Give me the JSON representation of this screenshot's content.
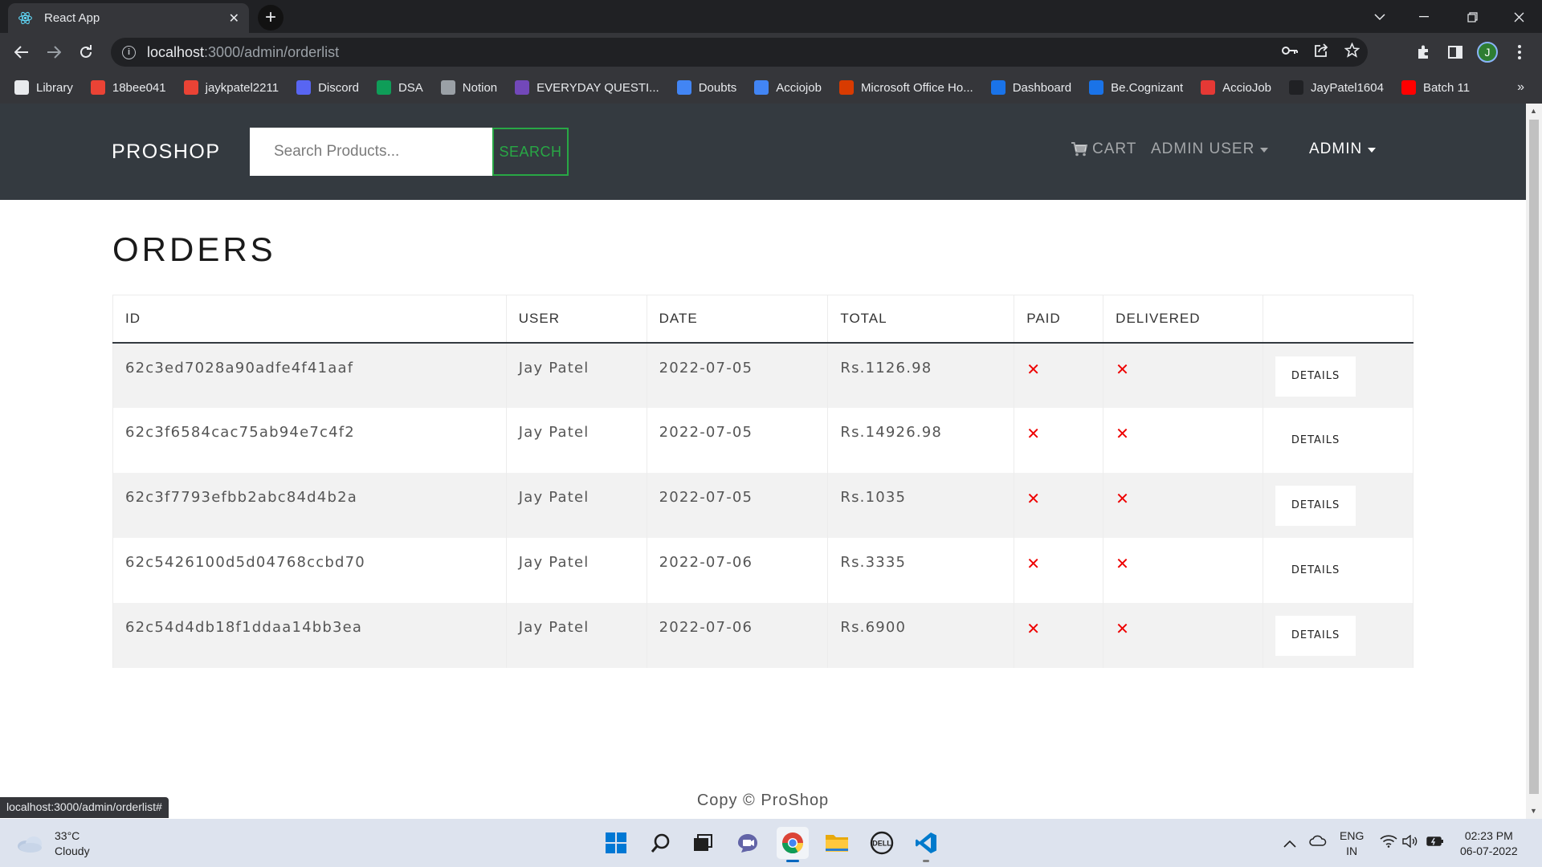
{
  "browser": {
    "tab_title": "React App",
    "url_host": "localhost",
    "url_path": ":3000/admin/orderlist",
    "profile_initial": "J",
    "bookmarks": [
      {
        "label": "Library",
        "icon": "library-icon",
        "color": "#e8eaed"
      },
      {
        "label": "18bee041",
        "icon": "gmail-icon",
        "color": "#ea4335"
      },
      {
        "label": "jaykpatel2211",
        "icon": "gmail-icon",
        "color": "#ea4335"
      },
      {
        "label": "Discord",
        "icon": "discord-icon",
        "color": "#5865f2"
      },
      {
        "label": "DSA",
        "icon": "sheets-icon",
        "color": "#0f9d58"
      },
      {
        "label": "Notion",
        "icon": "notion-icon",
        "color": "#9aa0a6"
      },
      {
        "label": "EVERYDAY QUESTI...",
        "icon": "forms-icon",
        "color": "#7248b9"
      },
      {
        "label": "Doubts",
        "icon": "docs-icon",
        "color": "#4285f4"
      },
      {
        "label": "Acciojob",
        "icon": "docs-icon",
        "color": "#4285f4"
      },
      {
        "label": "Microsoft Office Ho...",
        "icon": "office-icon",
        "color": "#d83b01"
      },
      {
        "label": "Dashboard",
        "icon": "cognizant-icon",
        "color": "#1a73e8"
      },
      {
        "label": "Be.Cognizant",
        "icon": "cognizant-icon",
        "color": "#1a73e8"
      },
      {
        "label": "AccioJob",
        "icon": "code-icon",
        "color": "#e53935"
      },
      {
        "label": "JayPatel1604",
        "icon": "github-icon",
        "color": "#202124"
      },
      {
        "label": "Batch 11",
        "icon": "youtube-icon",
        "color": "#ff0000"
      }
    ],
    "bookmarks_more": "»",
    "status_url": "localhost:3000/admin/orderlist#"
  },
  "navbar": {
    "brand": "PROSHOP",
    "search_placeholder": "Search Products...",
    "search_button": "SEARCH",
    "cart_label": "CART",
    "user_menu_label": "ADMIN USER",
    "admin_menu_label": "ADMIN"
  },
  "page": {
    "title": "ORDERS",
    "columns": [
      "ID",
      "USER",
      "DATE",
      "TOTAL",
      "PAID",
      "DELIVERED",
      ""
    ],
    "orders": [
      {
        "id": "62c3ed7028a90adfe4f41aaf",
        "user": "Jay Patel",
        "date": "2022-07-05",
        "total": "Rs.1126.98",
        "paid": "✕",
        "delivered": "✕",
        "action": "DETAILS"
      },
      {
        "id": "62c3f6584cac75ab94e7c4f2",
        "user": "Jay Patel",
        "date": "2022-07-05",
        "total": "Rs.14926.98",
        "paid": "✕",
        "delivered": "✕",
        "action": "DETAILS"
      },
      {
        "id": "62c3f7793efbb2abc84d4b2a",
        "user": "Jay Patel",
        "date": "2022-07-05",
        "total": "Rs.1035",
        "paid": "✕",
        "delivered": "✕",
        "action": "DETAILS"
      },
      {
        "id": "62c5426100d5d04768ccbd70",
        "user": "Jay Patel",
        "date": "2022-07-06",
        "total": "Rs.3335",
        "paid": "✕",
        "delivered": "✕",
        "action": "DETAILS"
      },
      {
        "id": "62c54d4db18f1ddaa14bb3ea",
        "user": "Jay Patel",
        "date": "2022-07-06",
        "total": "Rs.6900",
        "paid": "✕",
        "delivered": "✕",
        "action": "DETAILS"
      }
    ],
    "footer": "Copy © ProShop"
  },
  "taskbar": {
    "temperature": "33°C",
    "condition": "Cloudy",
    "language": "ENG",
    "region": "IN",
    "time": "02:23 PM",
    "date": "06-07-2022"
  },
  "colors": {
    "navbar_bg": "#343a40",
    "accent_green": "#28a745",
    "cross_red": "#ee0000"
  }
}
